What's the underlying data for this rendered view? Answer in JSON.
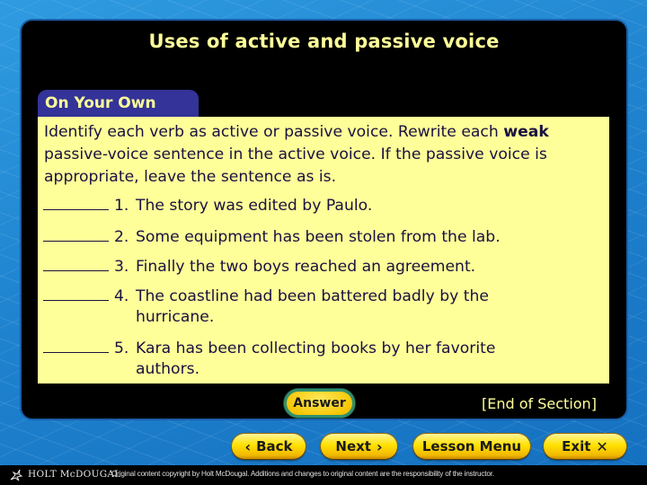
{
  "slide": {
    "title": "Uses of active and passive voice",
    "tab_label": "On Your Own",
    "instructions": {
      "part1": "Identify each verb as active or passive voice. Rewrite each",
      "bold_word": "weak",
      "part2": " passive-voice sentence in the active voice. If the passive voice is appropriate, leave the sentence as is."
    },
    "items": [
      {
        "number": "1.",
        "line1": "The story was edited by Paulo.",
        "line2": ""
      },
      {
        "number": "2.",
        "line1": "Some equipment has been stolen from the lab.",
        "line2": ""
      },
      {
        "number": "3.",
        "line1": "Finally the two boys reached an agreement.",
        "line2": ""
      },
      {
        "number": "4.",
        "line1": "The coastline had been battered badly by the",
        "line2": "hurricane."
      },
      {
        "number": "5.",
        "line1": "Kara has been collecting books by her favorite",
        "line2": "authors."
      }
    ],
    "answer_label": "Answer",
    "end_section": "[End of Section]"
  },
  "nav": {
    "back_label": "Back",
    "back_glyph": "‹",
    "next_label": "Next",
    "next_glyph": "›",
    "menu_label": "Lesson Menu",
    "exit_label": "Exit",
    "exit_glyph": "✕"
  },
  "footer": {
    "brand": "HOLT McDOUGAL",
    "copyright": "Original content copyright by Holt McDougal. Additions and changes to original content are the responsibility of the instructor."
  },
  "colors": {
    "title_text": "#ffff99",
    "tab_bg": "#333399",
    "content_bg": "#ffff99",
    "body_text": "#1a1040",
    "button_yellow": "#ffe100"
  }
}
